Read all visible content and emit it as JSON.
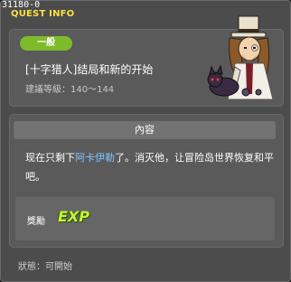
{
  "window": {
    "quest_id": "31180-0",
    "title": "QUEST INFO"
  },
  "quest": {
    "type_badge": "一般",
    "name": "[十字猎人]结局和新的开始",
    "level": "建議等級：140～144"
  },
  "content": {
    "header": "內容",
    "text_before": "现在只剩下",
    "text_highlight": "阿卡伊勒",
    "text_after": "了。消灭他，让冒险岛世界恢复和平吧。"
  },
  "reward": {
    "label": "獎勵",
    "exp_label": "EXP"
  },
  "status": {
    "text": "狀態：可開始"
  },
  "colors": {
    "title": "#ffe040",
    "badge": "#7dbb2a",
    "highlight": "#7fc4ff",
    "exp": "#c8f23a"
  },
  "icons": {
    "npc": "npc-portrait",
    "exp": "exp-icon"
  }
}
